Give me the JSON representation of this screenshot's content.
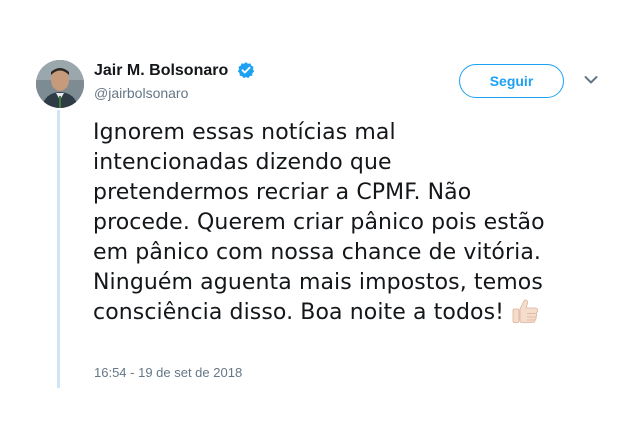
{
  "author": {
    "display_name": "Jair M. Bolsonaro",
    "username": "@jairbolsonaro",
    "verified": true,
    "avatar_icon": "profile-photo"
  },
  "actions": {
    "follow_label": "Seguir",
    "menu_icon": "chevron-down-icon"
  },
  "tweet": {
    "lines": [
      "Ignorem essas notícias mal",
      "intencionadas dizendo que",
      "pretendermos recriar a CPMF. Não",
      "procede. Querem criar pânico pois estão",
      "em pânico com nossa chance de vitória.",
      "Ninguém aguenta mais impostos, temos",
      "consciência disso. Boa noite a todos!"
    ],
    "emoji_icon": "thumbs-up-icon",
    "timestamp": "16:54 - 19 de set de 2018"
  },
  "colors": {
    "accent": "#1da1f2",
    "text": "#14171a",
    "secondary_text": "#657786",
    "thread_line": "#cfe5f6"
  }
}
